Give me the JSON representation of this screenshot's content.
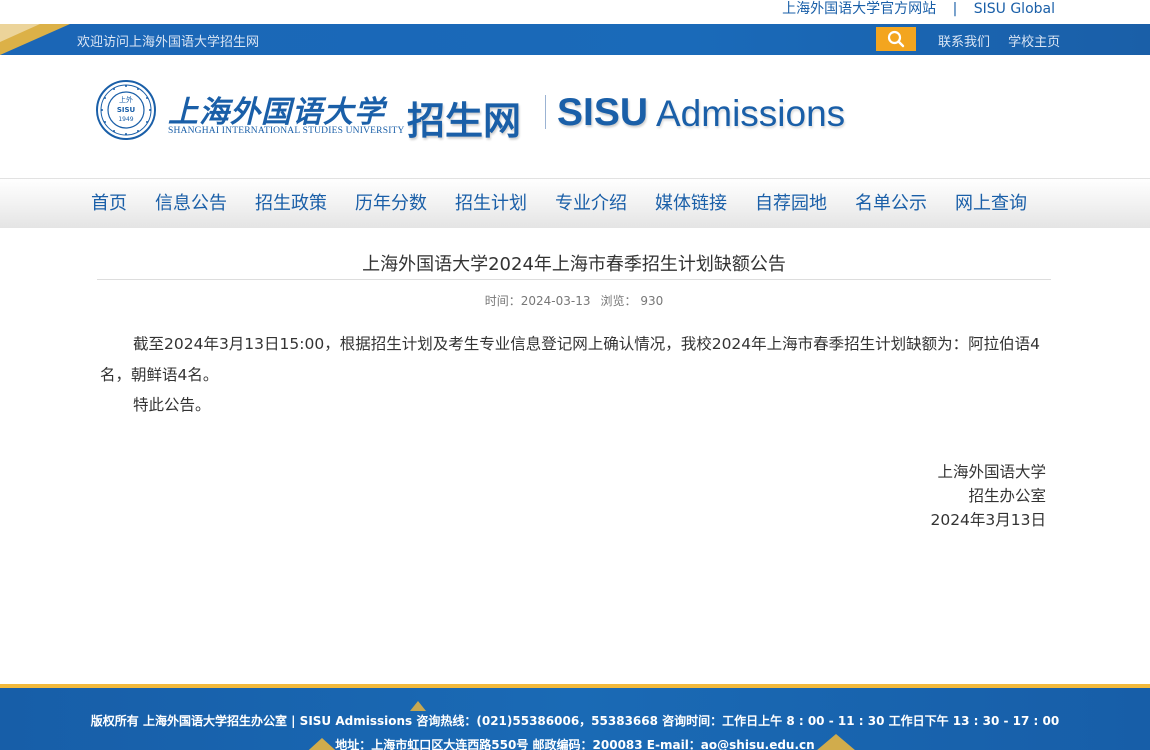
{
  "top_links": {
    "official_site": "上海外国语大学官方网站",
    "separator": "|",
    "global": "SISU Global"
  },
  "bar": {
    "welcome": "欢迎访问上海外国语大学招生网",
    "search_icon": "search-icon",
    "contact": "联系我们",
    "homepage": "学校主页"
  },
  "header": {
    "university_cn": "上海外国语大学",
    "university_en": "SHANGHAI INTERNATIONAL STUDIES UNIVERSITY",
    "seal_year": "1949",
    "seal_top": "上外",
    "seal_mid": "SISU",
    "site_cn": "招生网",
    "site_en_bold": "SISU",
    "site_en_light": "Admissions"
  },
  "nav": {
    "items": [
      "首页",
      "信息公告",
      "招生政策",
      "历年分数",
      "招生计划",
      "专业介绍",
      "媒体链接",
      "自荐园地",
      "名单公示",
      "网上查询"
    ]
  },
  "article": {
    "title": "上海外国语大学2024年上海市春季招生计划缺额公告",
    "time_label": "时间：",
    "time": "2024-03-13",
    "views_label": "浏览：",
    "views": "930",
    "paragraph1": "截至2024年3月13日15:00，根据招生计划及考生专业信息登记网上确认情况，我校2024年上海市春季招生计划缺额为：阿拉伯语4名，朝鲜语4名。",
    "paragraph2": "特此公告。",
    "sign_org": "上海外国语大学",
    "sign_dept": "招生办公室",
    "sign_date": "2024年3月13日"
  },
  "footer": {
    "line1": "版权所有 上海外国语大学招生办公室 | SISU Admissions 咨询热线：(021)55386006，55383668 咨询时间：工作日上午 8 : 00 - 11 : 30 工作日下午 13 : 30 - 17 : 00",
    "line2": "地址：上海市虹口区大连西路550号 邮政编码：200083 E-mail：ao@shisu.edu.cn"
  },
  "colors": {
    "brand_blue": "#1a5fa8",
    "accent_yellow": "#f2b93b",
    "search_orange": "#f3a51f"
  }
}
